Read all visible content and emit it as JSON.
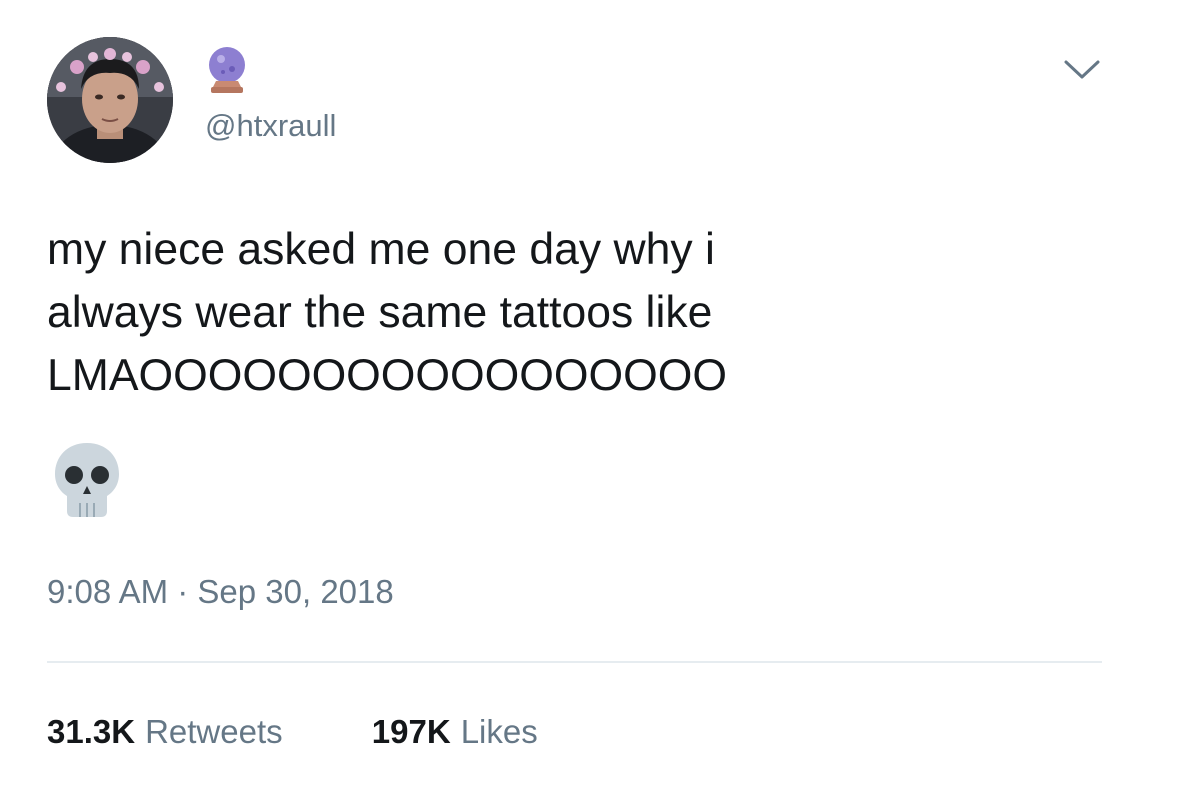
{
  "tweet": {
    "handle": "@htxraull",
    "name_emoji": "crystal-ball-icon",
    "text_lines": [
      "my niece asked me one day why i",
      "always wear the same tattoos like",
      "LMAOOOOOOOOOOOOOOOOO"
    ],
    "trailing_emoji": "skull-icon",
    "timestamp": "9:08 AM · Sep 30, 2018",
    "retweets_count": "31.3K",
    "retweets_label": "Retweets",
    "likes_count": "197K",
    "likes_label": "Likes"
  },
  "colors": {
    "text": "#14171a",
    "secondary": "#657786",
    "divider": "#e6ecf0",
    "crystal_ball": "#8d7fd1"
  }
}
